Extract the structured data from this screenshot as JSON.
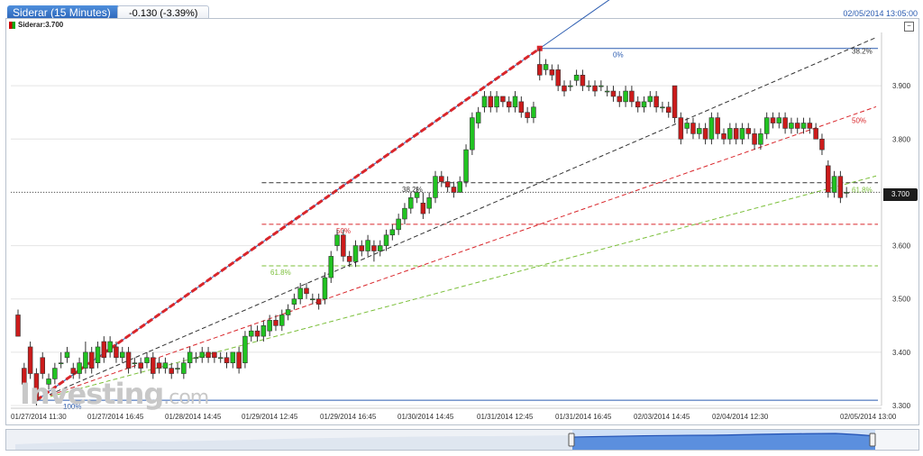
{
  "header": {
    "instrument_tab": "Siderar (15 Minutes)",
    "change": "-0.130 (-3.39%)",
    "datetime": "02/05/2014 13:05:00"
  },
  "legend": {
    "label": "Siderar:3.700"
  },
  "logo": {
    "text": "Investing",
    "suffix": ".com"
  },
  "last_price": "3.700",
  "colors": {
    "up": "#21c321",
    "down": "#cc1b1b",
    "trend": "#d9262b",
    "fib_0": "#2a5bb0",
    "fib_382": "#333333",
    "fib_50": "#d9262b",
    "fib_618": "#7bbf3a",
    "axis_text": "#333333"
  },
  "chart_data": {
    "type": "candlestick",
    "title": "",
    "y_ticks": [
      "3.300",
      "3.400",
      "3.500",
      "3.600",
      "3.700",
      "3.800",
      "3.900"
    ],
    "ylim": [
      3.3,
      4.0
    ],
    "x_ticks": [
      "01/27/2014 11:30",
      "01/27/2014 16:45",
      "01/28/2014 14:45",
      "01/29/2014 12:45",
      "01/29/2014 16:45",
      "01/30/2014 14:45",
      "01/31/2014 12:45",
      "01/31/2014 16:45",
      "02/03/2014 14:45",
      "02/04/2014 12:30",
      "02/05/2014 13:00"
    ],
    "fibonacci": {
      "low": 3.31,
      "high": 3.97,
      "levels": [
        {
          "label": "0%",
          "value": 3.97
        },
        {
          "label": "38.2%",
          "value": 3.718
        },
        {
          "label": "50%",
          "value": 3.64
        },
        {
          "label": "61.8%",
          "value": 3.562
        },
        {
          "label": "100%",
          "value": 3.31
        }
      ],
      "fan_labels": [
        "0%",
        "38.2%",
        "50%",
        "61.8%",
        "100%"
      ]
    },
    "candles": [
      [
        3.47,
        3.43,
        3.48,
        3.43
      ],
      [
        3.37,
        3.34,
        3.38,
        3.33
      ],
      [
        3.41,
        3.36,
        3.42,
        3.35
      ],
      [
        3.36,
        3.31,
        3.37,
        3.3
      ],
      [
        3.39,
        3.36,
        3.4,
        3.35
      ],
      [
        3.34,
        3.35,
        3.36,
        3.33
      ],
      [
        3.35,
        3.37,
        3.38,
        3.34
      ],
      [
        3.38,
        3.38,
        3.4,
        3.37
      ],
      [
        3.39,
        3.4,
        3.41,
        3.38
      ],
      [
        3.37,
        3.36,
        3.38,
        3.35
      ],
      [
        3.36,
        3.38,
        3.39,
        3.35
      ],
      [
        3.37,
        3.4,
        3.42,
        3.36
      ],
      [
        3.4,
        3.37,
        3.41,
        3.36
      ],
      [
        3.38,
        3.41,
        3.42,
        3.37
      ],
      [
        3.42,
        3.39,
        3.43,
        3.38
      ],
      [
        3.4,
        3.42,
        3.43,
        3.39
      ],
      [
        3.41,
        3.39,
        3.42,
        3.38
      ],
      [
        3.39,
        3.4,
        3.41,
        3.38
      ],
      [
        3.4,
        3.37,
        3.41,
        3.36
      ],
      [
        3.38,
        3.38,
        3.39,
        3.37
      ],
      [
        3.38,
        3.37,
        3.39,
        3.36
      ],
      [
        3.38,
        3.39,
        3.4,
        3.37
      ],
      [
        3.39,
        3.36,
        3.4,
        3.35
      ],
      [
        3.38,
        3.37,
        3.39,
        3.36
      ],
      [
        3.37,
        3.38,
        3.39,
        3.36
      ],
      [
        3.37,
        3.36,
        3.38,
        3.35
      ],
      [
        3.37,
        3.37,
        3.38,
        3.36
      ],
      [
        3.36,
        3.38,
        3.39,
        3.35
      ],
      [
        3.38,
        3.4,
        3.41,
        3.37
      ],
      [
        3.39,
        3.39,
        3.4,
        3.38
      ],
      [
        3.39,
        3.4,
        3.41,
        3.38
      ],
      [
        3.4,
        3.39,
        3.41,
        3.38
      ],
      [
        3.4,
        3.39,
        3.4,
        3.38
      ],
      [
        3.39,
        3.39,
        3.4,
        3.38
      ],
      [
        3.39,
        3.38,
        3.4,
        3.37
      ],
      [
        3.38,
        3.4,
        3.4,
        3.37
      ],
      [
        3.4,
        3.37,
        3.41,
        3.36
      ],
      [
        3.38,
        3.43,
        3.44,
        3.37
      ],
      [
        3.43,
        3.44,
        3.45,
        3.42
      ],
      [
        3.44,
        3.43,
        3.45,
        3.42
      ],
      [
        3.43,
        3.45,
        3.46,
        3.42
      ],
      [
        3.44,
        3.46,
        3.47,
        3.43
      ],
      [
        3.46,
        3.45,
        3.47,
        3.44
      ],
      [
        3.45,
        3.47,
        3.48,
        3.44
      ],
      [
        3.47,
        3.48,
        3.49,
        3.46
      ],
      [
        3.49,
        3.5,
        3.51,
        3.48
      ],
      [
        3.5,
        3.52,
        3.53,
        3.49
      ],
      [
        3.52,
        3.51,
        3.53,
        3.5
      ],
      [
        3.5,
        3.5,
        3.51,
        3.49
      ],
      [
        3.5,
        3.49,
        3.51,
        3.48
      ],
      [
        3.5,
        3.54,
        3.55,
        3.49
      ],
      [
        3.54,
        3.58,
        3.59,
        3.53
      ],
      [
        3.6,
        3.62,
        3.63,
        3.59
      ],
      [
        3.62,
        3.58,
        3.63,
        3.57
      ],
      [
        3.58,
        3.57,
        3.59,
        3.56
      ],
      [
        3.57,
        3.6,
        3.61,
        3.56
      ],
      [
        3.6,
        3.59,
        3.61,
        3.58
      ],
      [
        3.59,
        3.61,
        3.62,
        3.58
      ],
      [
        3.6,
        3.59,
        3.61,
        3.57
      ],
      [
        3.59,
        3.6,
        3.61,
        3.58
      ],
      [
        3.6,
        3.62,
        3.63,
        3.59
      ],
      [
        3.62,
        3.63,
        3.64,
        3.61
      ],
      [
        3.63,
        3.65,
        3.66,
        3.62
      ],
      [
        3.65,
        3.67,
        3.68,
        3.64
      ],
      [
        3.67,
        3.69,
        3.7,
        3.66
      ],
      [
        3.69,
        3.7,
        3.71,
        3.68
      ],
      [
        3.68,
        3.66,
        3.7,
        3.65
      ],
      [
        3.67,
        3.69,
        3.7,
        3.66
      ],
      [
        3.69,
        3.73,
        3.74,
        3.68
      ],
      [
        3.73,
        3.72,
        3.74,
        3.71
      ],
      [
        3.72,
        3.71,
        3.73,
        3.7
      ],
      [
        3.71,
        3.7,
        3.72,
        3.69
      ],
      [
        3.7,
        3.72,
        3.73,
        3.7
      ],
      [
        3.72,
        3.78,
        3.79,
        3.71
      ],
      [
        3.78,
        3.84,
        3.85,
        3.77
      ],
      [
        3.83,
        3.85,
        3.86,
        3.82
      ],
      [
        3.86,
        3.88,
        3.89,
        3.85
      ],
      [
        3.88,
        3.86,
        3.89,
        3.85
      ],
      [
        3.86,
        3.88,
        3.89,
        3.85
      ],
      [
        3.88,
        3.87,
        3.88,
        3.86
      ],
      [
        3.87,
        3.86,
        3.88,
        3.85
      ],
      [
        3.86,
        3.88,
        3.89,
        3.85
      ],
      [
        3.87,
        3.85,
        3.88,
        3.84
      ],
      [
        3.85,
        3.84,
        3.86,
        3.83
      ],
      [
        3.84,
        3.86,
        3.87,
        3.83
      ],
      [
        3.94,
        3.92,
        3.97,
        3.91
      ],
      [
        3.93,
        3.94,
        3.95,
        3.92
      ],
      [
        3.93,
        3.92,
        3.94,
        3.91
      ],
      [
        3.93,
        3.9,
        3.94,
        3.89
      ],
      [
        3.9,
        3.89,
        3.91,
        3.88
      ],
      [
        3.9,
        3.9,
        3.91,
        3.89
      ],
      [
        3.91,
        3.92,
        3.93,
        3.9
      ],
      [
        3.92,
        3.9,
        3.93,
        3.89
      ],
      [
        3.9,
        3.9,
        3.91,
        3.89
      ],
      [
        3.9,
        3.89,
        3.91,
        3.88
      ],
      [
        3.9,
        3.9,
        3.91,
        3.89
      ],
      [
        3.89,
        3.89,
        3.9,
        3.88
      ],
      [
        3.89,
        3.88,
        3.9,
        3.87
      ],
      [
        3.88,
        3.87,
        3.89,
        3.86
      ],
      [
        3.87,
        3.89,
        3.9,
        3.86
      ],
      [
        3.89,
        3.87,
        3.9,
        3.86
      ],
      [
        3.87,
        3.86,
        3.88,
        3.85
      ],
      [
        3.86,
        3.87,
        3.88,
        3.85
      ],
      [
        3.87,
        3.88,
        3.89,
        3.86
      ],
      [
        3.88,
        3.86,
        3.89,
        3.85
      ],
      [
        3.86,
        3.86,
        3.87,
        3.85
      ],
      [
        3.86,
        3.85,
        3.87,
        3.84
      ],
      [
        3.9,
        3.84,
        3.9,
        3.83
      ],
      [
        3.84,
        3.8,
        3.85,
        3.79
      ],
      [
        3.82,
        3.83,
        3.84,
        3.81
      ],
      [
        3.83,
        3.81,
        3.84,
        3.8
      ],
      [
        3.81,
        3.82,
        3.83,
        3.8
      ],
      [
        3.82,
        3.8,
        3.83,
        3.79
      ],
      [
        3.8,
        3.84,
        3.85,
        3.79
      ],
      [
        3.84,
        3.81,
        3.85,
        3.8
      ],
      [
        3.81,
        3.8,
        3.82,
        3.79
      ],
      [
        3.8,
        3.82,
        3.83,
        3.79
      ],
      [
        3.82,
        3.8,
        3.83,
        3.79
      ],
      [
        3.8,
        3.82,
        3.83,
        3.79
      ],
      [
        3.82,
        3.81,
        3.83,
        3.8
      ],
      [
        3.81,
        3.79,
        3.82,
        3.78
      ],
      [
        3.79,
        3.81,
        3.82,
        3.78
      ],
      [
        3.81,
        3.84,
        3.85,
        3.8
      ],
      [
        3.84,
        3.83,
        3.85,
        3.82
      ],
      [
        3.83,
        3.84,
        3.85,
        3.82
      ],
      [
        3.84,
        3.82,
        3.85,
        3.81
      ],
      [
        3.82,
        3.83,
        3.84,
        3.81
      ],
      [
        3.83,
        3.82,
        3.84,
        3.81
      ],
      [
        3.82,
        3.83,
        3.84,
        3.81
      ],
      [
        3.83,
        3.82,
        3.84,
        3.81
      ],
      [
        3.82,
        3.8,
        3.83,
        3.8
      ],
      [
        3.8,
        3.78,
        3.81,
        3.77
      ],
      [
        3.75,
        3.7,
        3.76,
        3.69
      ],
      [
        3.7,
        3.73,
        3.74,
        3.69
      ],
      [
        3.73,
        3.69,
        3.74,
        3.68
      ],
      [
        3.7,
        3.7,
        3.71,
        3.69
      ]
    ]
  }
}
